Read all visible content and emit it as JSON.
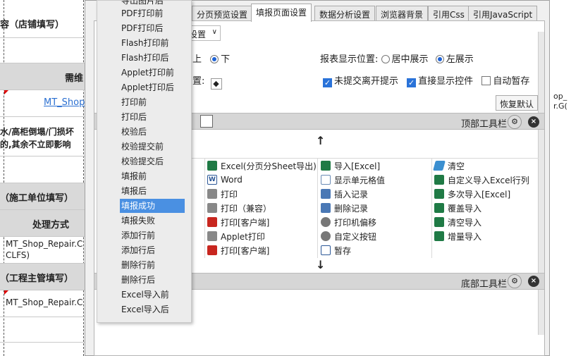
{
  "sheet": {
    "left_cells": [
      "容（店铺填写）",
      "",
      "",
      "水/高柜倒塌/门损坏",
      "的,其余不立即影响",
      "",
      "（施工单位填写）",
      "处理方式",
      "MT_Shop_Repair.C",
      "CLFS)",
      "（工程主管填写）",
      "MT_Shop_Repair.C"
    ],
    "mid_header": "需维",
    "link": "MT_Shop",
    "right_code_1": "op_",
    "right_code_2": "r.G("
  },
  "dialog": {
    "tabs": [
      "分页预览设置",
      "填报页面设置",
      "数据分析设置",
      "浏览器背景",
      "引用Css",
      "引用JavaScript"
    ],
    "active_tab": "填报页面设置",
    "setting_select": "设置",
    "pos_label_fragment": "上",
    "pos_down": "下",
    "report_pos_label": "报表显示位置:",
    "report_pos_center": "居中展示",
    "report_pos_left": "左展示",
    "fragment_setting": "置:",
    "cb_unsubmitted": "未提交离开提示",
    "cb_direct_show": "直接显示控件",
    "cb_auto_save": "自动暂存",
    "restore_default": "恢复默认",
    "top_toolbar": "顶部工具栏",
    "bottom_toolbar": "底部工具栏"
  },
  "toolbar_items": [
    {
      "label": "Excel(分页分Sheet导出)",
      "icon": "excel-icon"
    },
    {
      "label": "导入[Excel]",
      "icon": "excel-icon"
    },
    {
      "label": "清空",
      "icon": "eraser-icon"
    },
    {
      "label": "Word",
      "icon": "word-icon"
    },
    {
      "label": "显示单元格值",
      "icon": "cell-icon"
    },
    {
      "label": "自定义导入Excel行列",
      "icon": "excel-icon"
    },
    {
      "label": "打印",
      "icon": "printer-icon"
    },
    {
      "label": "插入记录",
      "icon": "insert-record-icon"
    },
    {
      "label": "多次导入[Excel]",
      "icon": "excel-icon"
    },
    {
      "label": "打印（兼容）",
      "icon": "printer-icon"
    },
    {
      "label": "删除记录",
      "icon": "delete-record-icon"
    },
    {
      "label": "覆盖导入",
      "icon": "excel-icon"
    },
    {
      "label": "打印[客户端]",
      "icon": "print-client-icon"
    },
    {
      "label": "打印机偏移",
      "icon": "move-icon"
    },
    {
      "label": "清空导入",
      "icon": "excel-icon"
    },
    {
      "label": "Applet打印",
      "icon": "applet-icon"
    },
    {
      "label": "自定义按钮",
      "icon": "gear-icon"
    },
    {
      "label": "增量导入",
      "icon": "excel-icon"
    },
    {
      "label": "打印[客户端]",
      "icon": "pdf-icon"
    },
    {
      "label": "暂存",
      "icon": "clock-icon"
    },
    {
      "label": "",
      "icon": ""
    }
  ],
  "menu": {
    "items": [
      "导出图片后",
      "PDF打印前",
      "PDF打印后",
      "Flash打印前",
      "Flash打印后",
      "Applet打印前",
      "Applet打印后",
      "打印前",
      "打印后",
      "校验后",
      "校验提交前",
      "校验提交后",
      "填报前",
      "填报后",
      "填报成功",
      "填报失败",
      "添加行前",
      "添加行后",
      "删除行前",
      "删除行后",
      "Excel导入前",
      "Excel导入后"
    ],
    "selected": "填报成功"
  },
  "colors": {
    "accent": "#4a90e2",
    "toolbar_bar": "#d6d6d6"
  }
}
